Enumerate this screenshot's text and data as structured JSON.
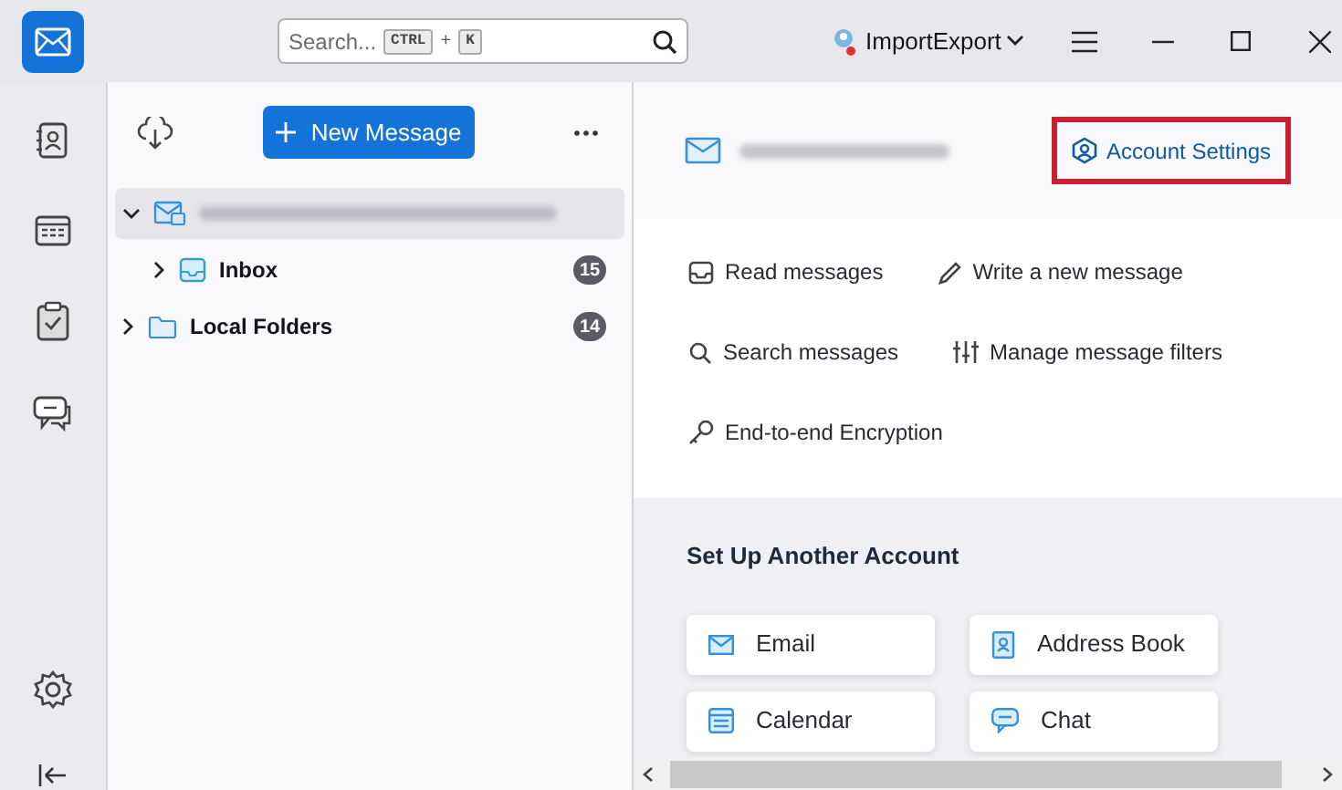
{
  "search": {
    "placeholder": "Search...",
    "shortcut": [
      "CTRL",
      "+",
      "K"
    ]
  },
  "profile": {
    "name": "ImportExport"
  },
  "spaces": [
    {
      "kind": "address-book",
      "selected": false
    },
    {
      "kind": "calendar",
      "selected": false
    },
    {
      "kind": "tasks",
      "selected": false
    },
    {
      "kind": "chat",
      "selected": false
    }
  ],
  "new_message": {
    "label": "New Message"
  },
  "folders": [
    {
      "kind": "account",
      "expanded": true,
      "selected": true,
      "children": [
        {
          "kind": "inbox",
          "label": "Inbox",
          "count": "15",
          "expanded": false,
          "selected": false
        }
      ]
    },
    {
      "kind": "local",
      "label": "Local Folders",
      "count": "14",
      "expanded": false,
      "selected": false
    }
  ],
  "account_settings": {
    "label": "Account Settings",
    "highlighted": true
  },
  "actions": [
    [
      {
        "kind": "read",
        "label": "Read messages"
      },
      {
        "kind": "write",
        "label": "Write a new message"
      }
    ],
    [
      {
        "kind": "search",
        "label": "Search messages"
      },
      {
        "kind": "filters",
        "label": "Manage message filters"
      }
    ],
    [
      {
        "kind": "key",
        "label": "End-to-end Encryption"
      }
    ]
  ],
  "setup": {
    "title": "Set Up Another Account",
    "cards": [
      {
        "kind": "email",
        "label": "Email"
      },
      {
        "kind": "address-book",
        "label": "Address Book"
      },
      {
        "kind": "calendar",
        "label": "Calendar"
      },
      {
        "kind": "chat",
        "label": "Chat"
      }
    ]
  }
}
